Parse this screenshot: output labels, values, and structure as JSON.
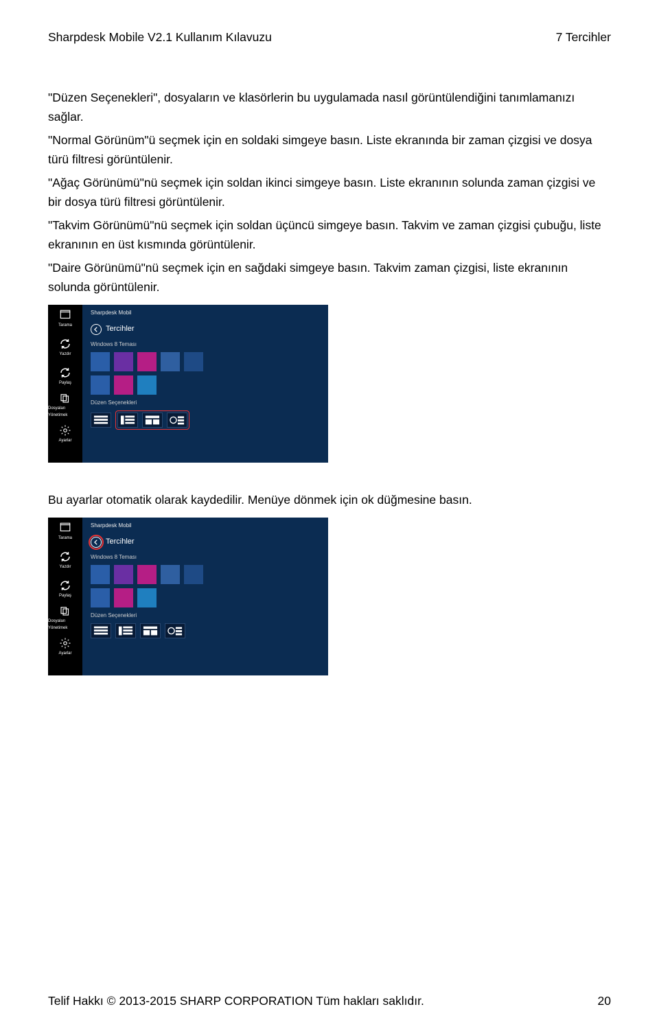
{
  "header": {
    "left": "Sharpdesk Mobile V2.1 Kullanım Kılavuzu",
    "right": "7 Tercihler"
  },
  "paragraphs": {
    "p1": "\"Düzen Seçenekleri\", dosyaların ve klasörlerin bu uygulamada nasıl görüntülendiğini tanımlamanızı sağlar.",
    "p2": "\"Normal Görünüm\"ü seçmek için en soldaki simgeye basın. Liste ekranında bir zaman çizgisi ve dosya türü filtresi görüntülenir.",
    "p3": "\"Ağaç Görünümü\"nü seçmek için soldan ikinci simgeye basın. Liste ekranının solunda zaman çizgisi ve bir dosya türü filtresi görüntülenir.",
    "p4": "\"Takvim Görünümü\"nü seçmek için soldan üçüncü simgeye basın. Takvim ve zaman çizgisi çubuğu, liste ekranının en üst kısmında görüntülenir.",
    "p5": "\"Daire Görünümü\"nü seçmek için en sağdaki simgeye basın. Takvim zaman çizgisi, liste ekranının solunda görüntülenir.",
    "p6": "Bu ayarlar otomatik olarak kaydedilir. Menüye dönmek için ok düğmesine basın."
  },
  "screenshot": {
    "appname": "Sharpdesk Mobil",
    "title": "Tercihler",
    "section_theme": "Windows 8 Teması",
    "section_layout": "Düzen Seçenekleri",
    "sidebar": {
      "s1": "Tarama",
      "s2": "Yazdır",
      "s3": "Paylaş",
      "s4": "Dosyaları Yönetimek",
      "s5": "Ayarlar"
    },
    "swatches_row1": [
      "#2a5ea8",
      "#6a2fa3",
      "#b51e85",
      "#2f5fa0",
      "#1e4a85"
    ],
    "swatches_row2": [
      "#2a5ea8",
      "#b51e85",
      "#1f7fbf"
    ]
  },
  "footer": {
    "left": "Telif Hakkı © 2013-2015 SHARP CORPORATION Tüm hakları saklıdır.",
    "right": "20"
  }
}
